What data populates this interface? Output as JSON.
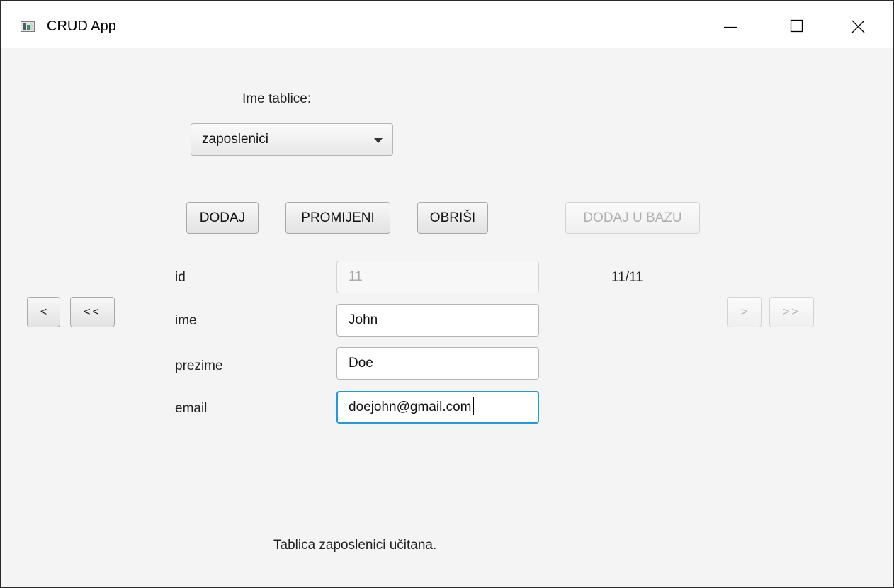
{
  "window": {
    "title": "CRUD App"
  },
  "table_select": {
    "label": "Ime tablice:",
    "selected": "zaposlenici"
  },
  "toolbar": {
    "add": "DODAJ",
    "change": "PROMIJENI",
    "delete": "OBRIŠI",
    "add_to_db": "DODAJ U BAZU"
  },
  "navigation": {
    "prev": "<",
    "first": "<<",
    "next": ">",
    "last": ">>",
    "record_counter": "11/11"
  },
  "form": {
    "fields": [
      {
        "label": "id",
        "value": "11",
        "readonly": true
      },
      {
        "label": "ime",
        "value": "John"
      },
      {
        "label": "prezime",
        "value": "Doe"
      },
      {
        "label": "email",
        "value": "doejohn@gmail.com",
        "focused": true
      }
    ]
  },
  "status": {
    "message": "Tablica zaposlenici učitana."
  },
  "colors": {
    "focus_ring": "#1e9bdc",
    "background": "#f4f4f4"
  }
}
